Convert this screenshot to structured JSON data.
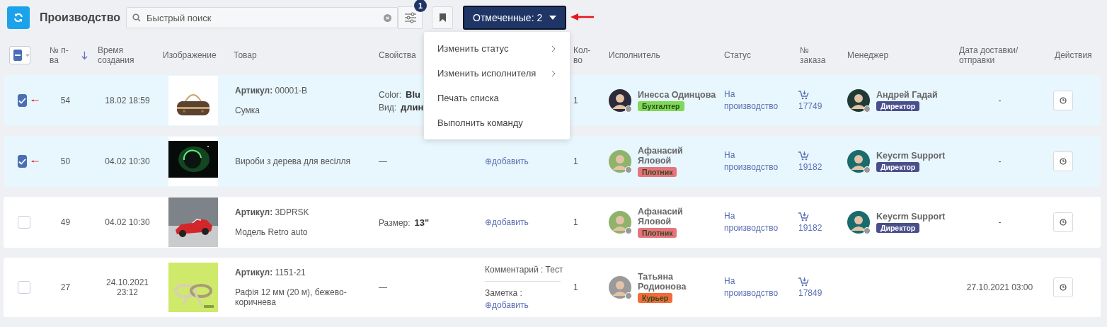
{
  "toolbar": {
    "title": "Производство",
    "search": {
      "placeholder": "Быстрый поиск"
    },
    "filter_badge": "1",
    "marked_button": "Отмеченные: 2"
  },
  "menu": {
    "items": [
      {
        "label": "Изменить статус",
        "submenu": true
      },
      {
        "label": "Изменить исполнителя",
        "submenu": true
      },
      {
        "label": "Печать списка",
        "submenu": false
      },
      {
        "label": "Выполнить команду",
        "submenu": false
      }
    ]
  },
  "table": {
    "select_all": {
      "indeterminate": true
    },
    "columns": [
      {
        "label": "№ п-ва",
        "sorted": true
      },
      {
        "label": "Время создания"
      },
      {
        "label": "Изображение"
      },
      {
        "label": "Товар"
      },
      {
        "label": "Свойства"
      },
      {
        "label": "Кол-во"
      },
      {
        "label": "Исполнитель"
      },
      {
        "label": "Статус"
      },
      {
        "label": "№ заказа"
      },
      {
        "label": "Менеджер"
      },
      {
        "label": "Дата доставки/ отправки"
      },
      {
        "label": "Действия"
      }
    ],
    "rows": [
      {
        "selected": true,
        "number": "54",
        "created": "18.02 18:59",
        "article_label": "Артикул:",
        "article": "00001-B",
        "name": "Сумка",
        "properties": [
          {
            "label": "Color:",
            "value": "Blu"
          },
          {
            "label": "Вид:",
            "value": "длин"
          }
        ],
        "qty": "1",
        "executor": {
          "name": "Инесса Одинцова",
          "role": "Бухгалтер",
          "color": "#7ed957"
        },
        "status": "На производство",
        "order": "17749",
        "manager": {
          "name": "Андрей Гадай",
          "role": "Директор",
          "color": "#4a4f8c"
        },
        "date": "-"
      },
      {
        "selected": true,
        "number": "50",
        "created": "04.02 10:30",
        "name": "Вироби з дерева для весілля",
        "no_properties": "—",
        "comment": {
          "add": "⊕добавить"
        },
        "qty": "1",
        "executor": {
          "name": "Афанасий Яловой",
          "role": "Плотник",
          "color": "#e8737f"
        },
        "status": "На производство",
        "order": "19182",
        "manager": {
          "name": "Keycrm Support",
          "role": "Директор",
          "color": "#4a4f8c"
        },
        "date": "-"
      },
      {
        "selected": false,
        "number": "49",
        "created": "04.02 10:30",
        "article_label": "Артикул:",
        "article": "3DPRSK",
        "name": "Модель Retro auto",
        "properties": [
          {
            "label": "Размер:",
            "value": "13\""
          }
        ],
        "comment": {
          "add": "⊕добавить"
        },
        "qty": "1",
        "executor": {
          "name": "Афанасий Яловой",
          "role": "Плотник",
          "color": "#e8737f"
        },
        "status": "На производство",
        "order": "19182",
        "manager": {
          "name": "Keycrm Support",
          "role": "Директор",
          "color": "#4a4f8c"
        },
        "date": "-"
      },
      {
        "selected": false,
        "number": "27",
        "created": "24.10.2021 23:12",
        "article_label": "Артикул:",
        "article": "1151-21",
        "name": "Рафія 12 мм (20 м), бежево-коричнева",
        "no_properties": "—",
        "comment": {
          "text": "Комментарий : Тест",
          "note": "Заметка :",
          "add": "⊕добавить"
        },
        "qty": "1",
        "executor": {
          "name": "Татьяна Родионова",
          "role": "Курьер",
          "color": "#f26b3a"
        },
        "status": "На производство",
        "order": "17849",
        "date": "27.10.2021 03:00"
      }
    ]
  }
}
